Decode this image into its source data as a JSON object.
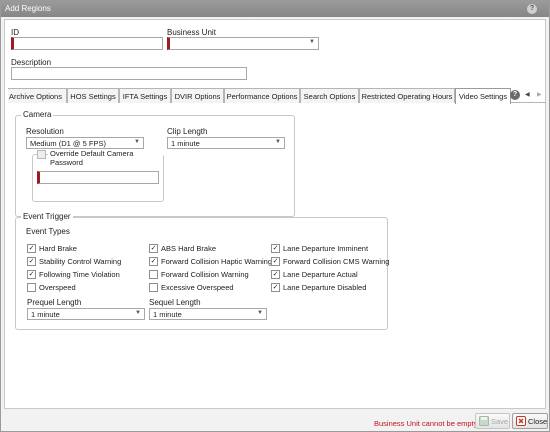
{
  "window": {
    "title": "Add Regions"
  },
  "fields": {
    "id_label": "ID",
    "id_value": "",
    "business_unit_label": "Business Unit",
    "business_unit_value": "",
    "description_label": "Description",
    "description_value": ""
  },
  "tabs": [
    {
      "label": "Archive Options"
    },
    {
      "label": "HOS Settings"
    },
    {
      "label": "IFTA Settings"
    },
    {
      "label": "DVIR Options"
    },
    {
      "label": "Performance Options"
    },
    {
      "label": "Search Options"
    },
    {
      "label": "Restricted Operating Hours"
    },
    {
      "label": "Video Settings",
      "active": true
    }
  ],
  "camera": {
    "legend": "Camera",
    "resolution_label": "Resolution",
    "resolution_value": "Medium (D1 @ 5 FPS)",
    "clip_length_label": "Clip Length",
    "clip_length_value": "1 minute",
    "override_label": "Override Default Camera Password",
    "override_checked": false,
    "password_value": ""
  },
  "event_trigger": {
    "legend": "Event Trigger",
    "event_types_label": "Event Types",
    "col1": [
      {
        "label": "Hard Brake",
        "checked": true
      },
      {
        "label": "Stability Control Warning",
        "checked": true
      },
      {
        "label": "Following Time Violation",
        "checked": true
      },
      {
        "label": "Overspeed",
        "checked": false
      }
    ],
    "col2": [
      {
        "label": "ABS Hard Brake",
        "checked": true
      },
      {
        "label": "Forward Collision Haptic Warning",
        "checked": true
      },
      {
        "label": "Forward Collision Warning",
        "checked": false
      },
      {
        "label": "Excessive Overspeed",
        "checked": false
      }
    ],
    "col3": [
      {
        "label": "Lane Departure Imminent",
        "checked": true
      },
      {
        "label": "Forward Collision CMS Warning",
        "checked": true
      },
      {
        "label": "Lane Departure Actual",
        "checked": true
      },
      {
        "label": "Lane Departure Disabled",
        "checked": true
      }
    ],
    "prequel_label": "Prequel Length",
    "prequel_value": "1 minute",
    "sequel_label": "Sequel Length",
    "sequel_value": "1 minute"
  },
  "footer": {
    "status": "Business Unit cannot be empty",
    "save_label": "Save",
    "close_label": "Close"
  },
  "colors": {
    "required": "#9c1b24",
    "error": "#c1121f"
  }
}
